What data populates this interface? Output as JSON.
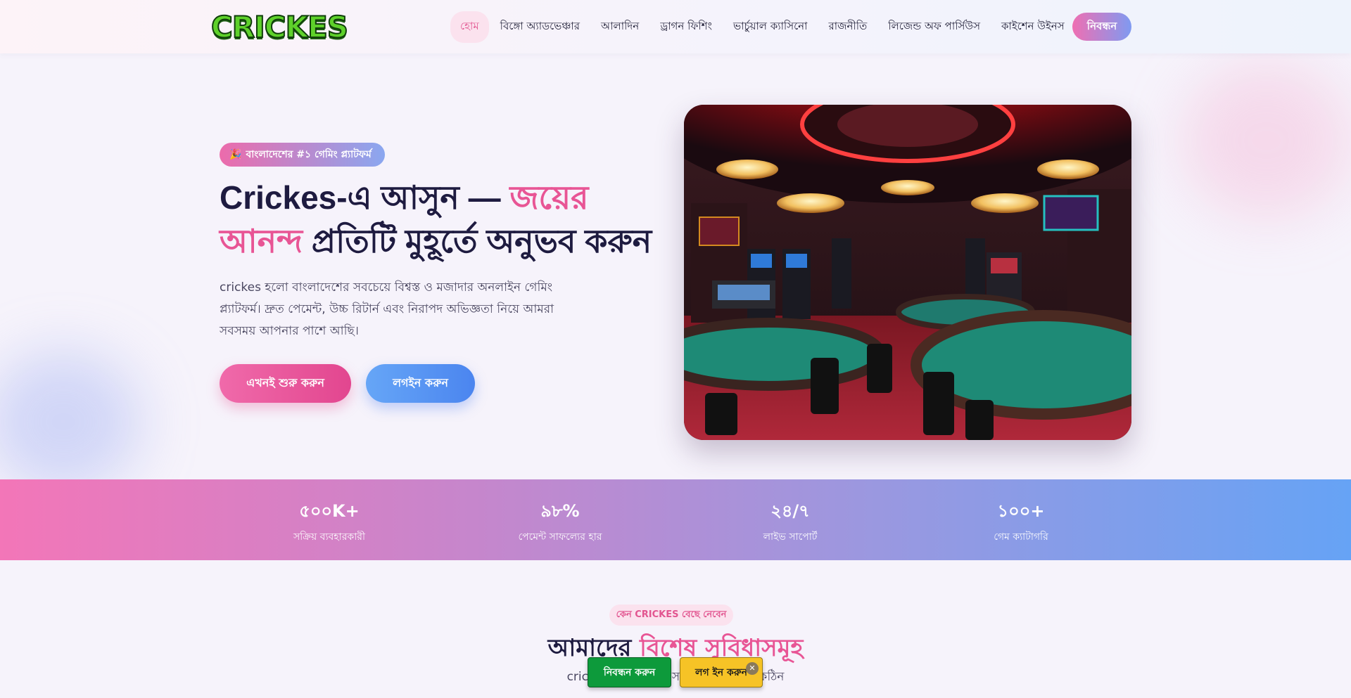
{
  "brand": {
    "logo_text": "CRICKES"
  },
  "nav": {
    "items": [
      {
        "label": "হোম",
        "active": true
      },
      {
        "label": "বিঙ্গো অ্যাডভেঞ্চার"
      },
      {
        "label": "আলাদিন"
      },
      {
        "label": "ড্রাগন ফিশিং"
      },
      {
        "label": "ভার্চুয়াল ক্যাসিনো"
      },
      {
        "label": "রাজনীতি"
      },
      {
        "label": "লিজেন্ড অফ পার্সিউস"
      },
      {
        "label": "কাইশেন উইনস"
      }
    ],
    "register_label": "নিবন্ধন"
  },
  "hero": {
    "badge_icon": "🎉",
    "badge_text": "বাংলাদেশের #১ গেমিং প্ল্যাটফর্ম",
    "title_part1": "Crickes-এ আসুন — ",
    "title_accent1": "জয়ের",
    "title_accent2": "আনন্দ",
    "title_part2": " প্রতিটি মুহূর্তে অনুভব করুন",
    "description": "crickes হলো বাংলাদেশের সবচেয়ে বিশ্বস্ত ও মজাদার অনলাইন গেমিং প্ল্যাটফর্ম। দ্রুত পেমেন্ট, উচ্চ রিটার্ন এবং নিরাপদ অভিজ্ঞতা নিয়ে আমরা সবসময় আপনার পাশে আছি।",
    "start_button": "এখনই শুরু করুন",
    "login_button": "লগইন করুন"
  },
  "stats": [
    {
      "value": "৫০০K+",
      "label": "সক্রিয় ব্যবহারকারী"
    },
    {
      "value": "৯৮%",
      "label": "পেমেন্ট সাফল্যের হার"
    },
    {
      "value": "২৪/৭",
      "label": "লাইভ সাপোর্ট"
    },
    {
      "value": "১০০+",
      "label": "গেম ক্যাটাগরি"
    }
  ],
  "features": {
    "badge": "কেন CRICKES বেছে নেবেন",
    "title_part1": "আমাদের ",
    "title_accent": "বিশেষ সুবিধাসমূহ",
    "description": "crickes প্ল্যাটফর্মে অ                                        স                    কোথাও পাওয়া কঠিন"
  },
  "floating_bar": {
    "register_label": "নিবন্ধন করুন",
    "login_label": "লগ ইন করুন",
    "close_glyph": "✕"
  },
  "colors": {
    "accent_pink": "#e85595",
    "accent_blue": "#4b85ef",
    "title_dark": "#1e1b40"
  }
}
